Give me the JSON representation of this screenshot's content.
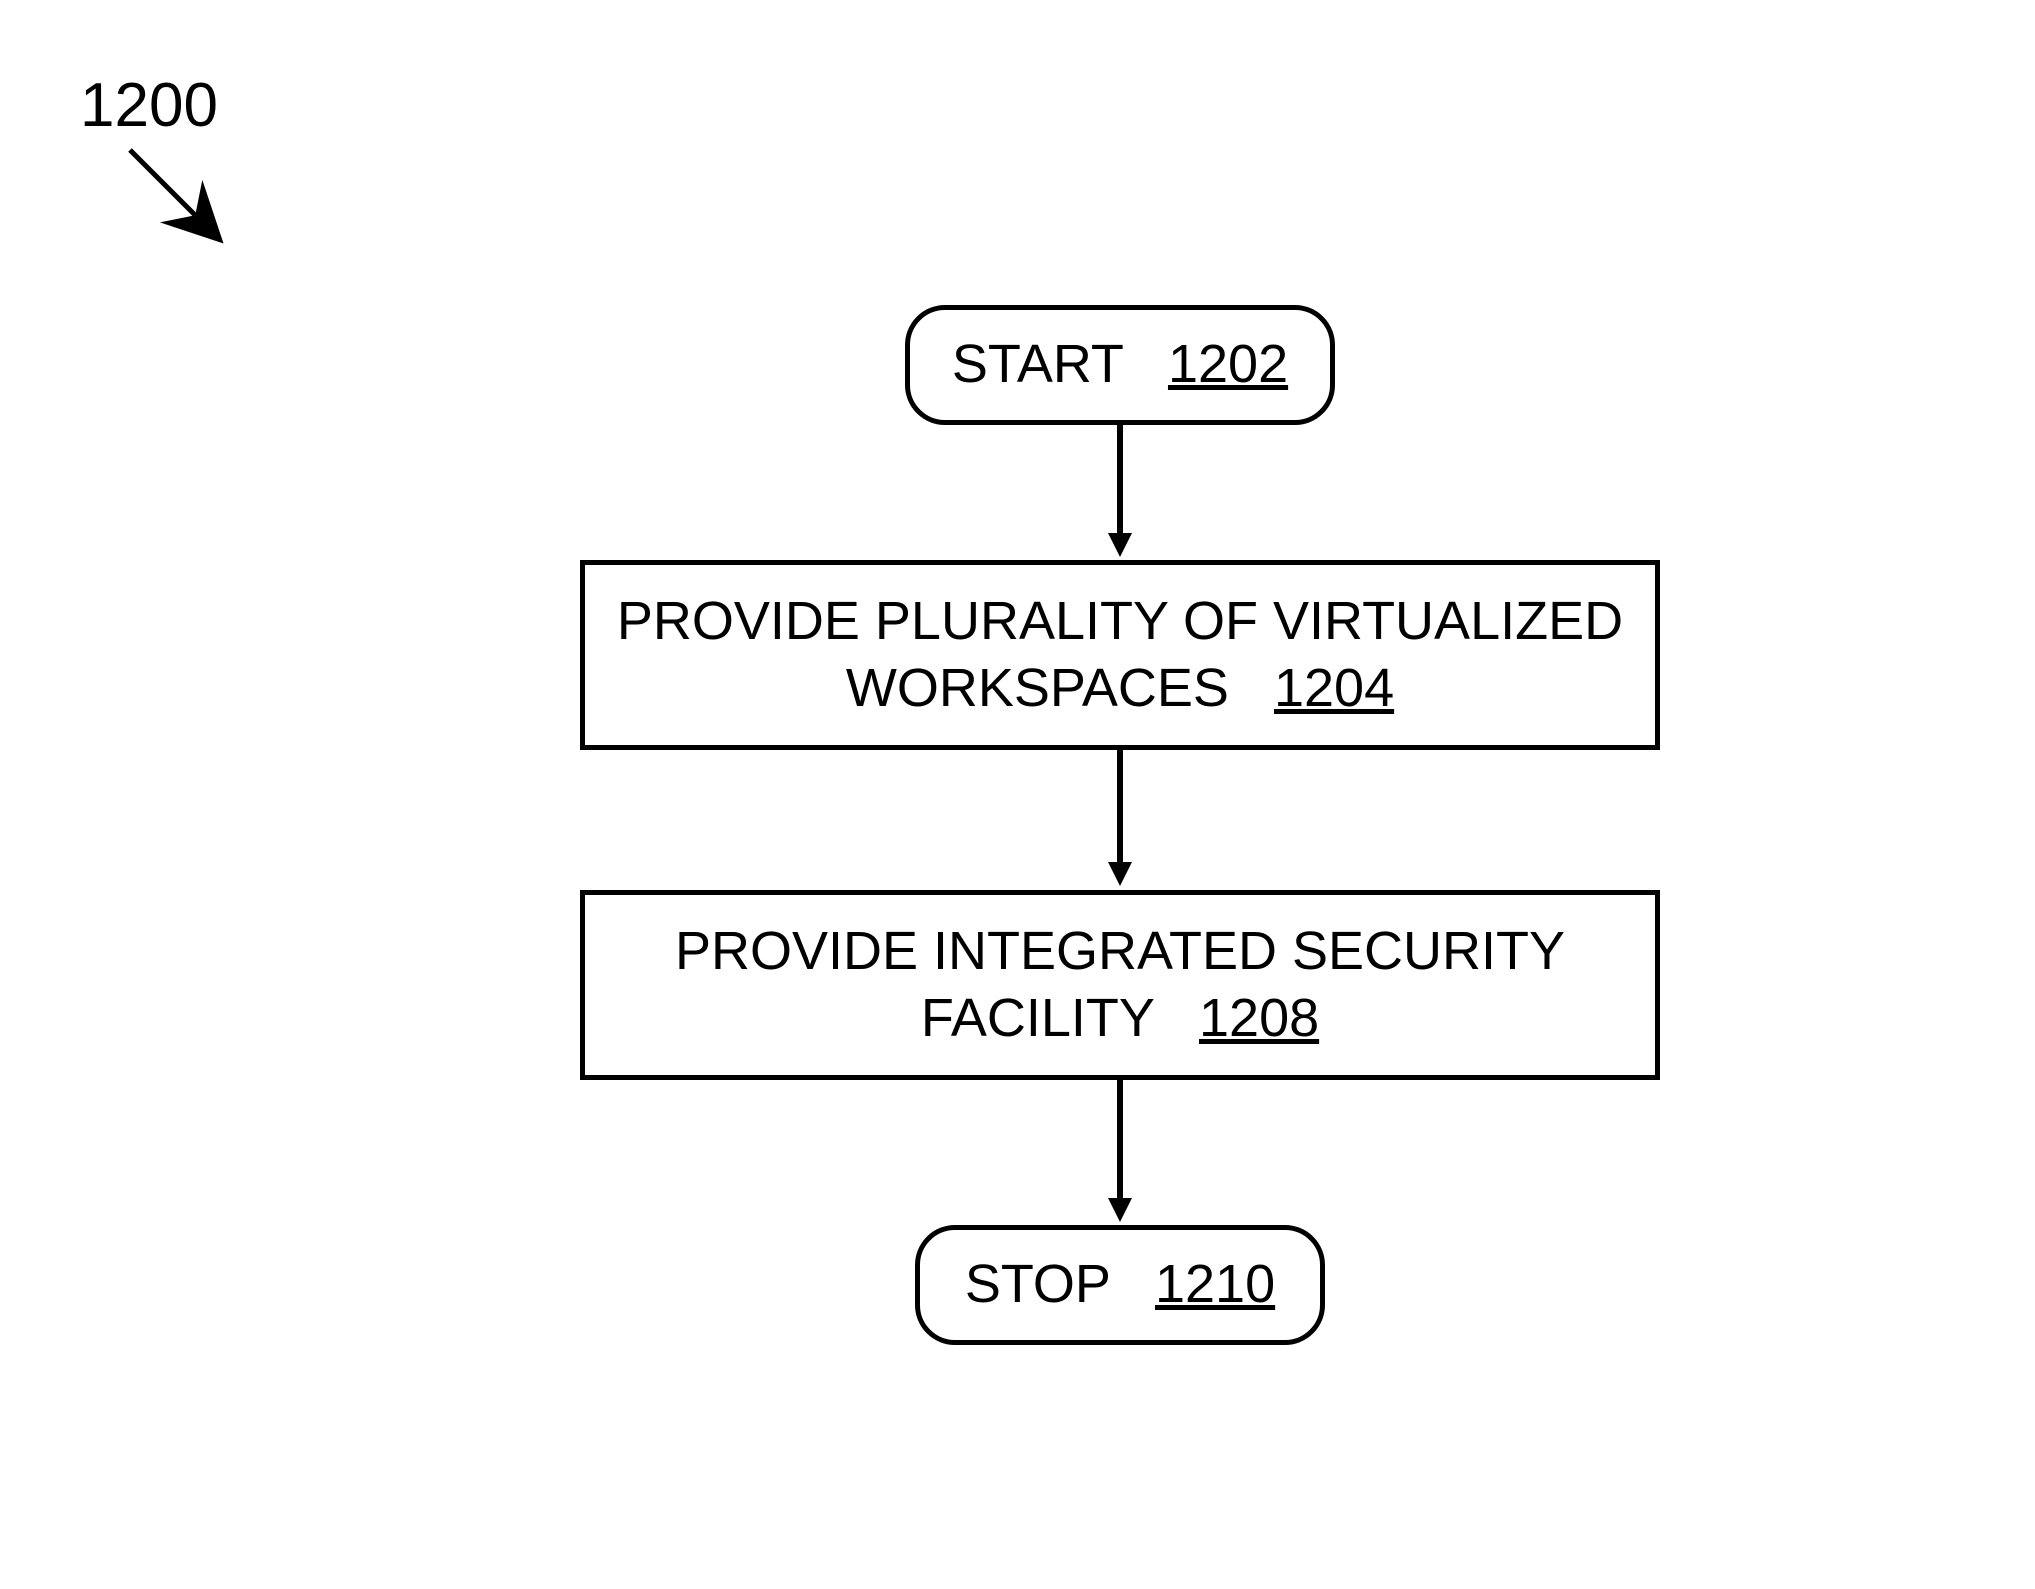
{
  "figure": {
    "label": "1200"
  },
  "nodes": {
    "start": {
      "text": "START",
      "ref": "1202"
    },
    "step1": {
      "text": "PROVIDE PLURALITY OF VIRTUALIZED WORKSPACES",
      "ref": "1204"
    },
    "step2": {
      "text": "PROVIDE INTEGRATED SECURITY FACILITY",
      "ref": "1208"
    },
    "stop": {
      "text": "STOP",
      "ref": "1210"
    }
  }
}
